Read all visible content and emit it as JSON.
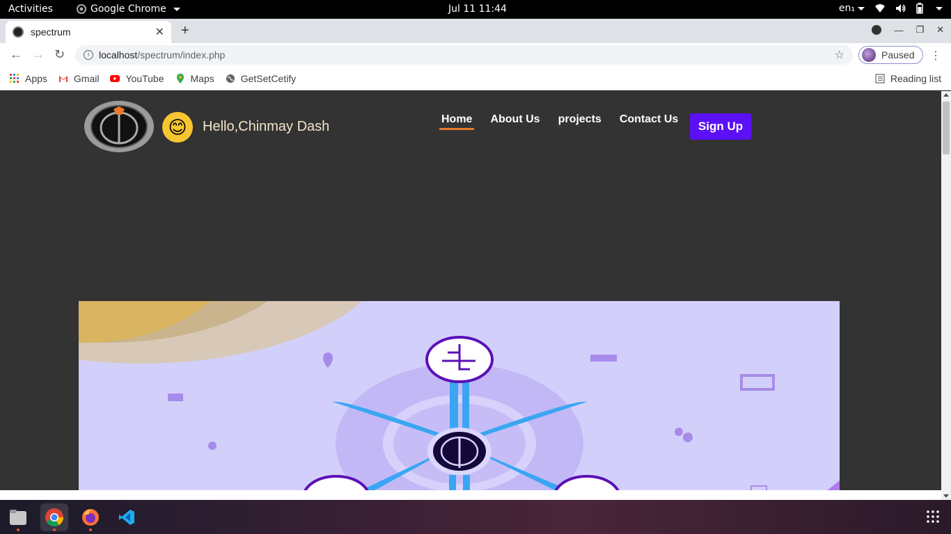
{
  "topbar": {
    "activities": "Activities",
    "app_name": "Google Chrome",
    "clock": "Jul 11  11:44",
    "keyboard_layout": "en₁"
  },
  "browser": {
    "tab_title": "spectrum",
    "url_host": "localhost",
    "url_path": "/spectrum/index.php",
    "profile_status": "Paused",
    "bookmarks": [
      {
        "label": "Apps",
        "icon": "apps-grid-icon"
      },
      {
        "label": "Gmail",
        "icon": "gmail-icon"
      },
      {
        "label": "YouTube",
        "icon": "youtube-icon"
      },
      {
        "label": "Maps",
        "icon": "maps-pin-icon"
      },
      {
        "label": "GetSetCetify",
        "icon": "globe-icon"
      }
    ],
    "reading_list": "Reading list"
  },
  "page": {
    "greeting": "Hello,Chinmay Dash",
    "emoji": "😊",
    "nav": [
      {
        "label": "Home",
        "active": true
      },
      {
        "label": "About Us",
        "active": false
      },
      {
        "label": "projects",
        "active": false
      },
      {
        "label": "Contact Us",
        "active": false
      }
    ],
    "signup_label": "Sign Up",
    "hero_bg": "#d2d0fb",
    "accent": "#5b10f5"
  },
  "dock": {
    "apps": [
      "files-icon",
      "chrome-icon",
      "firefox-icon",
      "vscode-icon"
    ]
  }
}
